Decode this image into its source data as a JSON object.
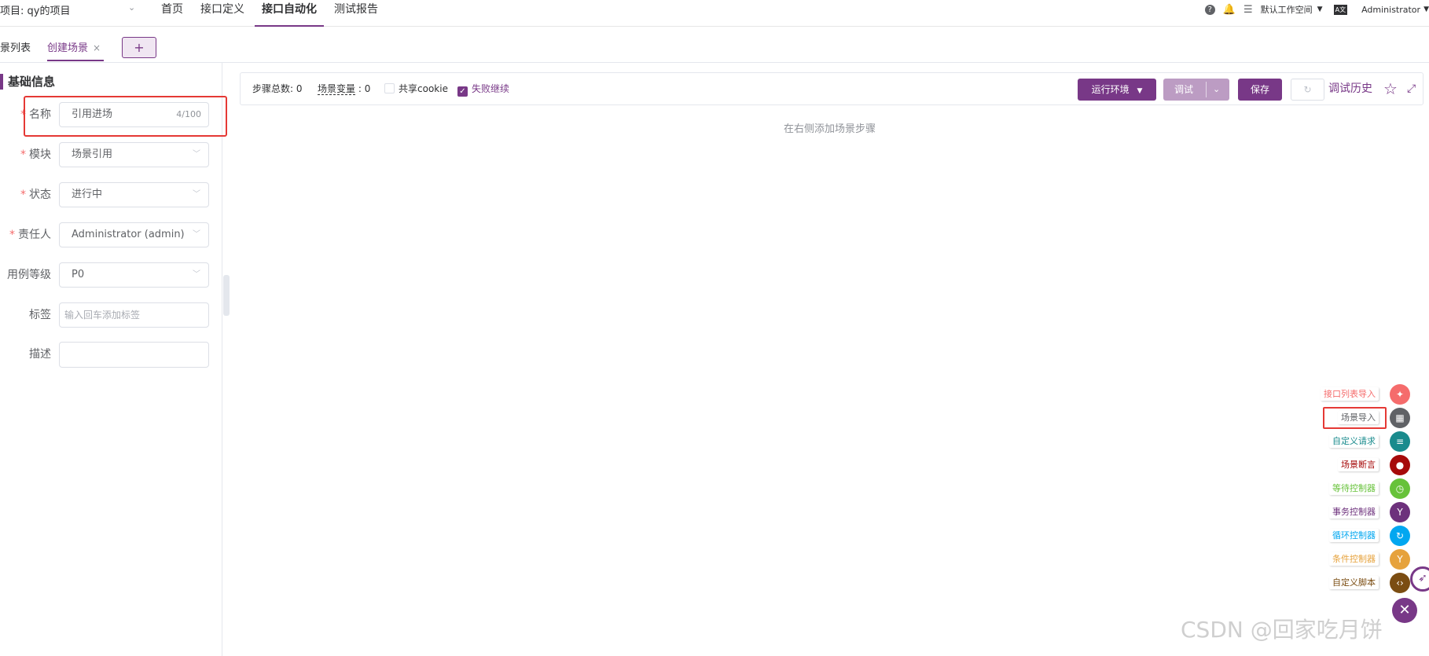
{
  "header": {
    "project_label": "项目: qy的项目",
    "nav": [
      "首页",
      "接口定义",
      "接口自动化",
      "测试报告"
    ],
    "active_nav": "接口自动化",
    "workspace": "默认工作空间",
    "user": "Administrator",
    "lang_badge": "A文"
  },
  "tabs": {
    "list_tab": "景列表",
    "create_tab": "创建场景",
    "close_glyph": "×",
    "add_glyph": "+"
  },
  "form": {
    "section_title": "基础信息",
    "name": {
      "label": "名称",
      "value": "引用进场",
      "count": "4/100"
    },
    "module": {
      "label": "模块",
      "value": "场景引用"
    },
    "status": {
      "label": "状态",
      "value": "进行中"
    },
    "owner": {
      "label": "责任人",
      "value": "Administrator (admin)"
    },
    "level": {
      "label": "用例等级",
      "value": "P0"
    },
    "tags": {
      "label": "标签",
      "placeholder": "输入回车添加标签"
    },
    "desc": {
      "label": "描述",
      "value": ""
    }
  },
  "toolbar": {
    "steps_label": "步骤总数:",
    "steps_value": "0",
    "vars_label": "场景变量",
    "vars_value": "0",
    "share_cookie": "共享cookie",
    "fail_continue": "失败继续",
    "env_button": "运行环境",
    "debug_button": "调试",
    "save_button": "保存",
    "history": "调试历史"
  },
  "empty_text": "在右侧添加场景步骤",
  "float_menu": [
    {
      "label": "接口列表导入",
      "color": "#f56c6c",
      "icon": "api-icon",
      "glyph": "✦"
    },
    {
      "label": "场景导入",
      "color": "#606266",
      "icon": "scene-icon",
      "glyph": "▦"
    },
    {
      "label": "自定义请求",
      "color": "#1a8b8d",
      "icon": "custom-request-icon",
      "glyph": "≡"
    },
    {
      "label": "场景断言",
      "color": "#a60a0a",
      "icon": "assertion-icon",
      "glyph": "●"
    },
    {
      "label": "等待控制器",
      "color": "#67c23a",
      "icon": "wait-icon",
      "glyph": "◷"
    },
    {
      "label": "事务控制器",
      "color": "#6d317c",
      "icon": "transaction-icon",
      "glyph": "Y"
    },
    {
      "label": "循环控制器",
      "color": "#02a7f0",
      "icon": "loop-icon",
      "glyph": "↻"
    },
    {
      "label": "条件控制器",
      "color": "#e6a23c",
      "icon": "condition-icon",
      "glyph": "Y"
    },
    {
      "label": "自定义脚本",
      "color": "#7b4d12",
      "icon": "script-icon",
      "glyph": "‹›"
    }
  ],
  "watermark": "CSDN @回家吃月饼"
}
